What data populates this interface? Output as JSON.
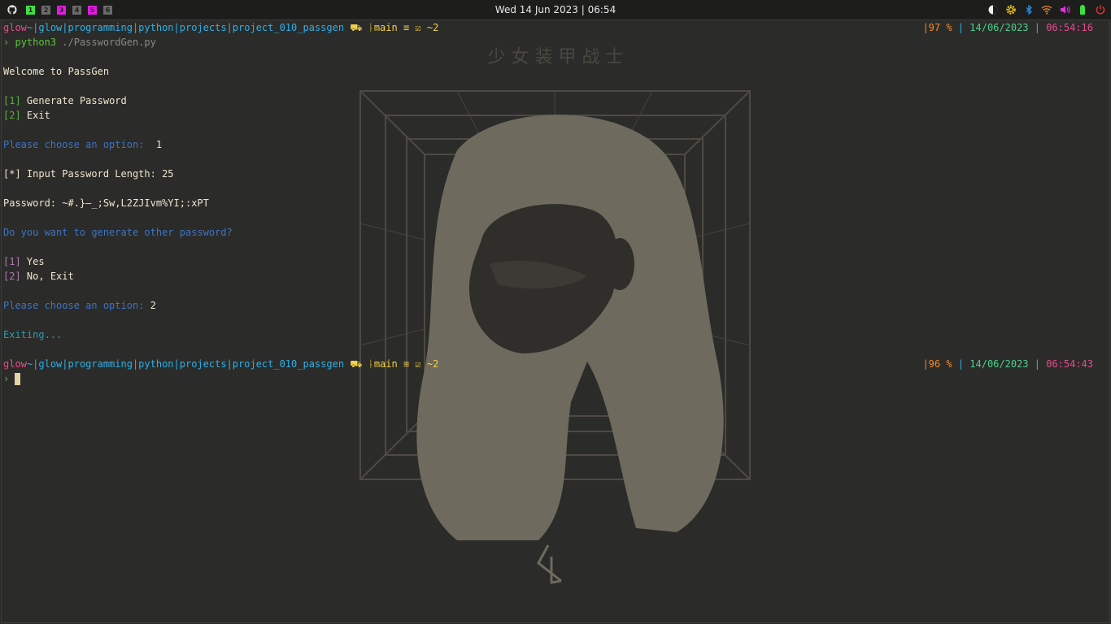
{
  "topbar": {
    "workspaces": [
      {
        "label": "1",
        "color": "#3fe13f"
      },
      {
        "label": "2",
        "color": "#6a6a6a"
      },
      {
        "label": "3",
        "color": "#e21be2"
      },
      {
        "label": "4",
        "color": "#6a6a6a"
      },
      {
        "label": "5",
        "color": "#e21be2"
      },
      {
        "label": "6",
        "color": "#6a6a6a"
      }
    ],
    "clock": "Wed 14 Jun 2023 | 06:54",
    "tray_icons": [
      "brightness-icon",
      "settings-icon",
      "bluetooth-icon",
      "wifi-icon",
      "volume-icon",
      "battery-icon",
      "power-icon"
    ]
  },
  "wallpaper": {
    "caption": "少 女 装 甲 战 士"
  },
  "terminal": {
    "prompt1": {
      "user": "glow",
      "tilde": "~",
      "path": "|glow|programming|python|projects|project_010_passgen",
      "git_icon": "⛟",
      "branch_sym": "ᚿ",
      "branch": "main",
      "git_status": "≡ ☑ ~2",
      "battery": "|97 %",
      "sep1": " | ",
      "date": "14/06/2023",
      "sep2": " | ",
      "time": "06:54:16"
    },
    "command": {
      "arrow": "›",
      "cmd": "python3",
      "arg": "./PasswordGen.py"
    },
    "welcome": "Welcome to PassGen",
    "menu1": [
      {
        "num": "[1]",
        "text": "Generate Password"
      },
      {
        "num": "[2]",
        "text": "Exit"
      }
    ],
    "choose1_label": "Please choose an option:",
    "choose1_value": " 1",
    "length_label": "[*] Input Password Length: 25",
    "password_line": "Password: ~#.}—_;Sw,L2ZJIvm%YI;:xPT",
    "again_question": "Do you want to generate other password?",
    "menu2": [
      {
        "num": "[1]",
        "text": "Yes"
      },
      {
        "num": "[2]",
        "text": "No, Exit"
      }
    ],
    "choose2_label": "Please choose an option:",
    "choose2_value": "2",
    "exiting": "Exiting...",
    "prompt2": {
      "user": "glow",
      "tilde": "~",
      "path": "|glow|programming|python|projects|project_010_passgen",
      "git_icon": "⛟",
      "branch_sym": "ᚿ",
      "branch": "main",
      "git_status": "≡ ☑ ~2",
      "battery": "|96 %",
      "sep1": " | ",
      "date": "14/06/2023",
      "sep2": " | ",
      "time": "06:54:43"
    },
    "input_arrow": "›"
  }
}
